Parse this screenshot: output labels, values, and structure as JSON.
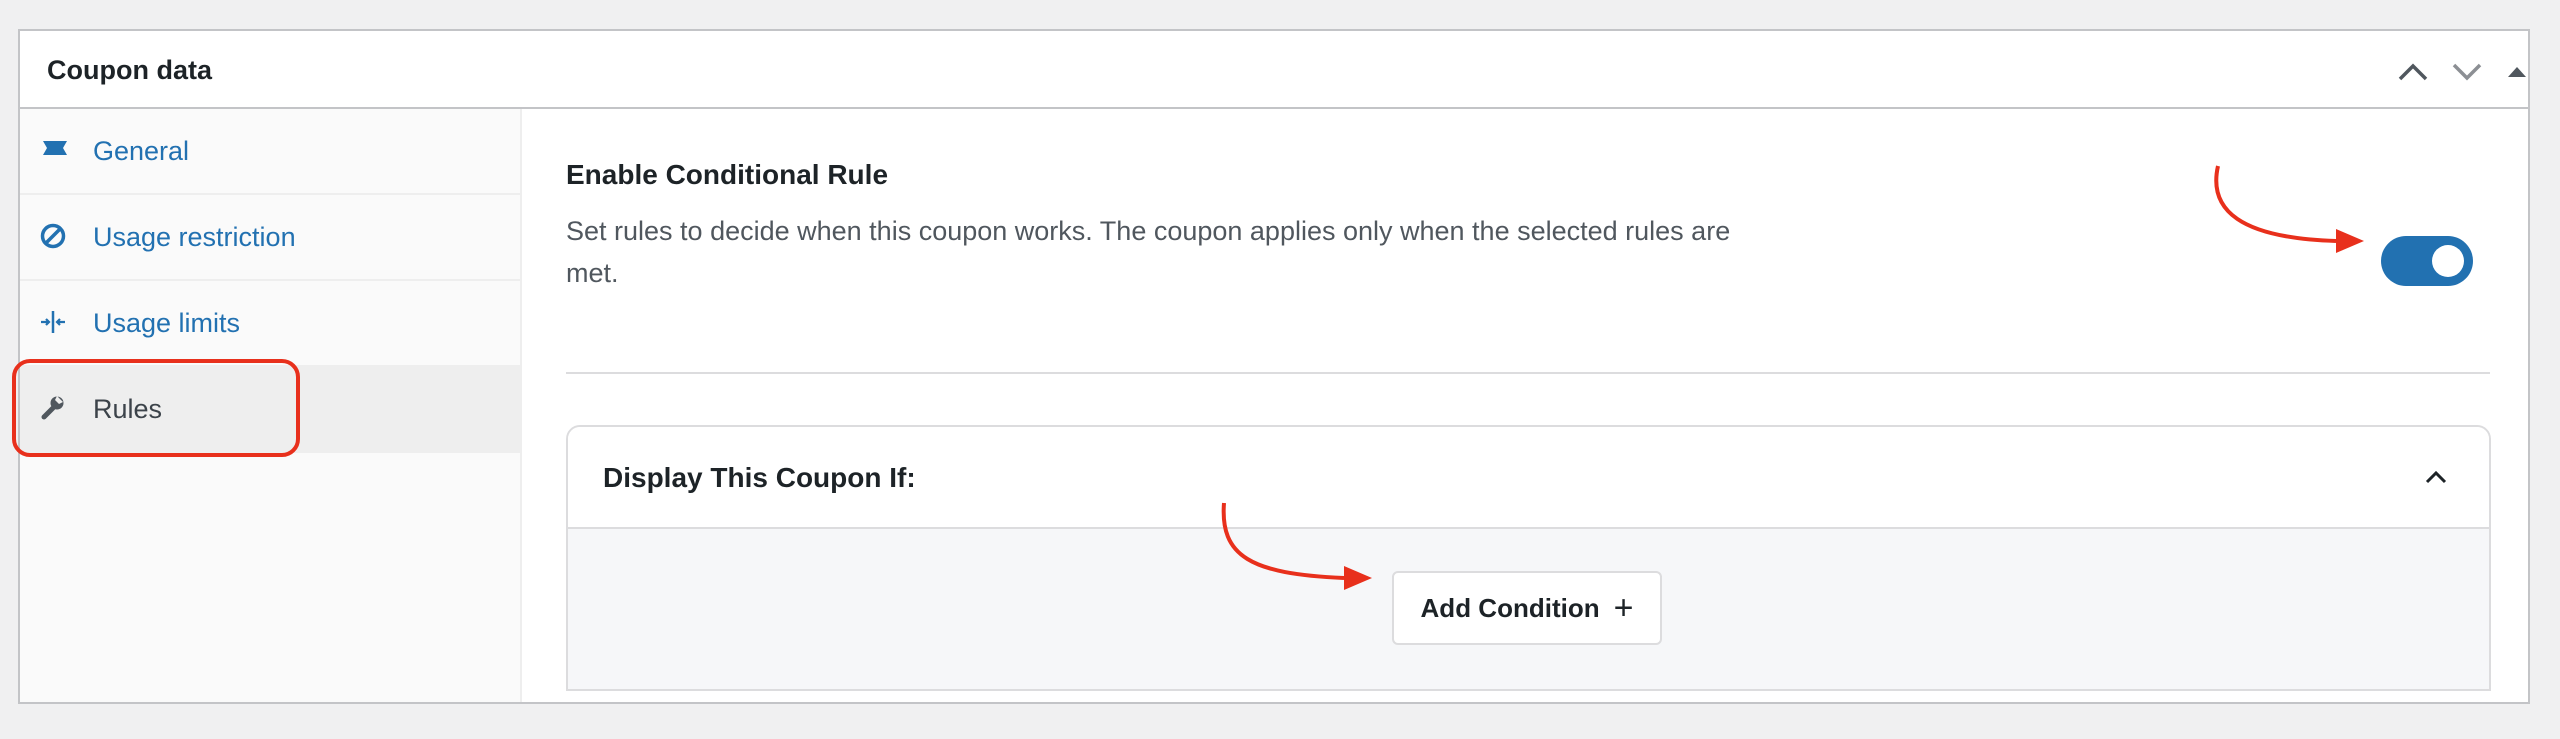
{
  "panel": {
    "title": "Coupon data",
    "controls": [
      "chevron-up-icon",
      "chevron-down-icon",
      "triangle-up-icon"
    ]
  },
  "sidebar": {
    "active": "Rules",
    "items": [
      {
        "label": "General",
        "icon": "ticket-icon"
      },
      {
        "label": "Usage restriction",
        "icon": "prohibited-icon"
      },
      {
        "label": "Usage limits",
        "icon": "limits-icon"
      },
      {
        "label": "Rules",
        "icon": "wrench-icon"
      }
    ]
  },
  "main": {
    "rule_title": "Enable Conditional Rule",
    "rule_description": "Set rules to decide when this coupon works. The coupon applies only when the selected rules are met.",
    "toggle_on": true,
    "condition_title": "Display This Coupon If:",
    "add_condition_label": "Add Condition",
    "add_condition_icon": "+"
  },
  "colors": {
    "accent": "#2271b1",
    "annotation": "#e8301c"
  }
}
